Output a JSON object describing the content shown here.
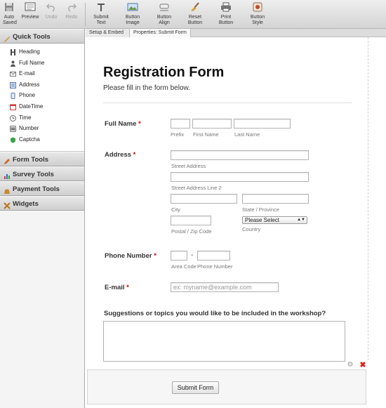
{
  "toolbar": {
    "buttons": [
      {
        "label1": "Auto",
        "label2": "Saved",
        "icon": "disk-icon"
      },
      {
        "label1": "Preview",
        "label2": "",
        "icon": "preview-icon"
      },
      {
        "label1": "Undo",
        "label2": "",
        "icon": "undo-icon"
      },
      {
        "label1": "Redo",
        "label2": "",
        "icon": "redo-icon"
      },
      {
        "label1": "Submit",
        "label2": "Text",
        "icon": "text-t-icon"
      },
      {
        "label1": "Button",
        "label2": "Image",
        "icon": "image-icon"
      },
      {
        "label1": "Button",
        "label2": "Align",
        "icon": "align-icon"
      },
      {
        "label1": "Reset",
        "label2": "Button",
        "icon": "broom-icon"
      },
      {
        "label1": "Print",
        "label2": "Button",
        "icon": "printer-icon"
      },
      {
        "label1": "Button",
        "label2": "Style",
        "icon": "style-icon"
      }
    ]
  },
  "sidebar": {
    "quick_tools_label": "Quick Tools",
    "quick_tools": [
      {
        "label": "Heading",
        "icon": "heading-icon"
      },
      {
        "label": "Full Name",
        "icon": "person-icon"
      },
      {
        "label": "E-mail",
        "icon": "envelope-icon"
      },
      {
        "label": "Address",
        "icon": "address-icon"
      },
      {
        "label": "Phone",
        "icon": "phone-icon"
      },
      {
        "label": "DateTime",
        "icon": "calendar-icon"
      },
      {
        "label": "Time",
        "icon": "clock-icon"
      },
      {
        "label": "Number",
        "icon": "number-icon"
      },
      {
        "label": "Captcha",
        "icon": "shield-icon"
      }
    ],
    "categories": [
      {
        "label": "Form Tools",
        "icon": "pencil-icon"
      },
      {
        "label": "Survey Tools",
        "icon": "chart-icon"
      },
      {
        "label": "Payment Tools",
        "icon": "money-icon"
      },
      {
        "label": "Widgets",
        "icon": "widgets-icon"
      }
    ]
  },
  "tabs": [
    {
      "label": "Setup & Embed"
    },
    {
      "label": "Properties: Submit Form"
    }
  ],
  "form": {
    "title": "Registration Form",
    "subtitle": "Please fill in the form below.",
    "required_mark": "*",
    "full_name": {
      "label": "Full Name",
      "prefix": "Prefix",
      "first": "First Name",
      "last": "Last Name"
    },
    "address": {
      "label": "Address",
      "street": "Street Address",
      "street2": "Street Address Line 2",
      "city": "City",
      "state": "State / Province",
      "zip": "Postal / Zip Code",
      "country_value": "Please Select",
      "country": "Country"
    },
    "phone": {
      "label": "Phone Number",
      "dash": "-",
      "area": "Area Code",
      "number": "Phone Number"
    },
    "email": {
      "label": "E-mail",
      "placeholder": "ex: myname@example.com"
    },
    "suggestions": {
      "label": "Suggestions or topics you would like to be included in the workshop?"
    },
    "submit_label": "Submit Form"
  },
  "colors": {
    "required": "#cc0000",
    "delete": "#dd2222"
  }
}
